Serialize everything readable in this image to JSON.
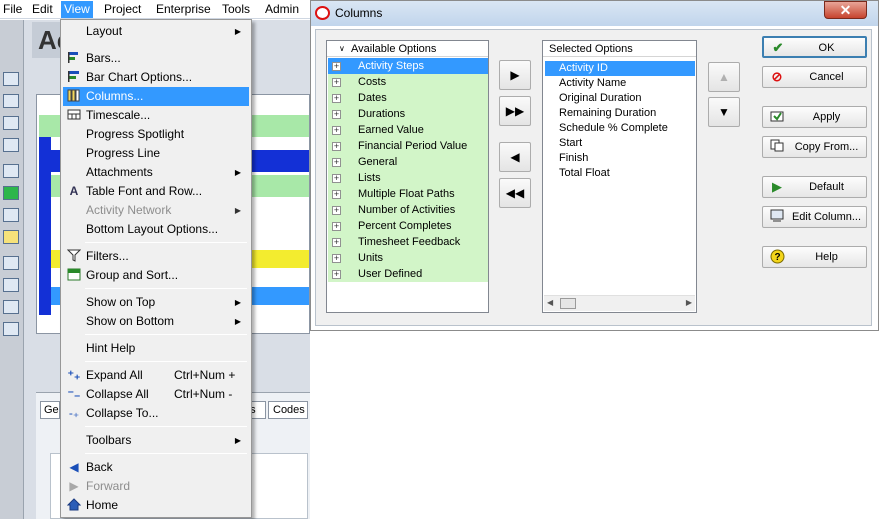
{
  "menubar": {
    "items": [
      "File",
      "Edit",
      "View",
      "Project",
      "Enterprise",
      "Tools",
      "Admin"
    ],
    "active": "View"
  },
  "app": {
    "title_fragment": "Ac"
  },
  "view_menu": {
    "items": [
      {
        "label": "Layout",
        "icon": "none",
        "submenu": true
      },
      {
        "label": "Bars...",
        "icon": "bars-icon"
      },
      {
        "label": "Bar Chart Options...",
        "icon": "bar-chart-options-icon"
      },
      {
        "label": "Columns...",
        "icon": "columns-icon",
        "selected": true
      },
      {
        "label": "Timescale...",
        "icon": "timescale-icon"
      },
      {
        "label": "Progress Spotlight",
        "icon": "none"
      },
      {
        "label": "Progress Line",
        "icon": "none"
      },
      {
        "label": "Attachments",
        "icon": "none",
        "submenu": true
      },
      {
        "label": "Table Font and Row...",
        "icon": "font-icon"
      },
      {
        "label": "Activity Network",
        "icon": "none",
        "submenu": true,
        "disabled": true
      },
      {
        "label": "Bottom Layout Options...",
        "icon": "none"
      },
      {
        "label": "Filters...",
        "icon": "filter-icon"
      },
      {
        "label": "Group and Sort...",
        "icon": "group-sort-icon"
      },
      {
        "label": "Show on Top",
        "icon": "none",
        "submenu": true
      },
      {
        "label": "Show on Bottom",
        "icon": "none",
        "submenu": true
      },
      {
        "label": "Hint Help",
        "icon": "none"
      },
      {
        "label": "Expand All",
        "icon": "expand-icon",
        "shortcut": "Ctrl+Num +"
      },
      {
        "label": "Collapse All",
        "icon": "collapse-icon",
        "shortcut": "Ctrl+Num -"
      },
      {
        "label": "Collapse To...",
        "icon": "collapse-to-icon"
      },
      {
        "label": "Toolbars",
        "icon": "none",
        "submenu": true
      },
      {
        "label": "Back",
        "icon": "back-icon"
      },
      {
        "label": "Forward",
        "icon": "forward-icon",
        "disabled": true
      },
      {
        "label": "Home",
        "icon": "home-icon"
      }
    ]
  },
  "dialog": {
    "title": "Columns",
    "available_header": "Available Options",
    "available": [
      "Activity Steps",
      "Costs",
      "Dates",
      "Durations",
      "Earned Value",
      "Financial Period Value",
      "General",
      "Lists",
      "Multiple Float Paths",
      "Number of Activities",
      "Percent Completes",
      "Timesheet Feedback",
      "Units",
      "User Defined"
    ],
    "available_selected": "Activity Steps",
    "selected_header": "Selected Options",
    "selected": [
      "Activity ID",
      "Activity Name",
      "Original Duration",
      "Remaining Duration",
      "Schedule % Complete",
      "Start",
      "Finish",
      "Total Float"
    ],
    "selected_highlight": "Activity ID",
    "buttons": {
      "ok": "OK",
      "cancel": "Cancel",
      "apply": "Apply",
      "copy_from": "Copy From...",
      "default": "Default",
      "edit_column": "Edit Column...",
      "help": "Help"
    }
  },
  "bottom_tabs": [
    "Ge",
    "ps",
    "Codes"
  ],
  "colors": {
    "menu_highlight": "#3399ff",
    "available_row": "#d2f5c8"
  }
}
